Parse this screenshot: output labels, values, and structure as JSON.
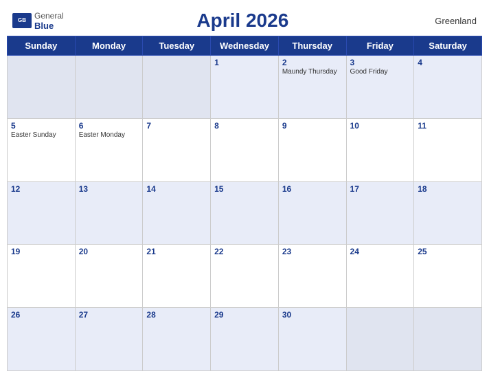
{
  "header": {
    "title": "April 2026",
    "region": "Greenland",
    "logo": {
      "general": "General",
      "blue": "Blue"
    }
  },
  "days_of_week": [
    "Sunday",
    "Monday",
    "Tuesday",
    "Wednesday",
    "Thursday",
    "Friday",
    "Saturday"
  ],
  "weeks": [
    [
      {
        "day": "",
        "holiday": ""
      },
      {
        "day": "",
        "holiday": ""
      },
      {
        "day": "",
        "holiday": ""
      },
      {
        "day": "1",
        "holiday": ""
      },
      {
        "day": "2",
        "holiday": "Maundy Thursday"
      },
      {
        "day": "3",
        "holiday": "Good Friday"
      },
      {
        "day": "4",
        "holiday": ""
      }
    ],
    [
      {
        "day": "5",
        "holiday": "Easter Sunday"
      },
      {
        "day": "6",
        "holiday": "Easter Monday"
      },
      {
        "day": "7",
        "holiday": ""
      },
      {
        "day": "8",
        "holiday": ""
      },
      {
        "day": "9",
        "holiday": ""
      },
      {
        "day": "10",
        "holiday": ""
      },
      {
        "day": "11",
        "holiday": ""
      }
    ],
    [
      {
        "day": "12",
        "holiday": ""
      },
      {
        "day": "13",
        "holiday": ""
      },
      {
        "day": "14",
        "holiday": ""
      },
      {
        "day": "15",
        "holiday": ""
      },
      {
        "day": "16",
        "holiday": ""
      },
      {
        "day": "17",
        "holiday": ""
      },
      {
        "day": "18",
        "holiday": ""
      }
    ],
    [
      {
        "day": "19",
        "holiday": ""
      },
      {
        "day": "20",
        "holiday": ""
      },
      {
        "day": "21",
        "holiday": ""
      },
      {
        "day": "22",
        "holiday": ""
      },
      {
        "day": "23",
        "holiday": ""
      },
      {
        "day": "24",
        "holiday": ""
      },
      {
        "day": "25",
        "holiday": ""
      }
    ],
    [
      {
        "day": "26",
        "holiday": ""
      },
      {
        "day": "27",
        "holiday": ""
      },
      {
        "day": "28",
        "holiday": ""
      },
      {
        "day": "29",
        "holiday": ""
      },
      {
        "day": "30",
        "holiday": ""
      },
      {
        "day": "",
        "holiday": ""
      },
      {
        "day": "",
        "holiday": ""
      }
    ]
  ]
}
